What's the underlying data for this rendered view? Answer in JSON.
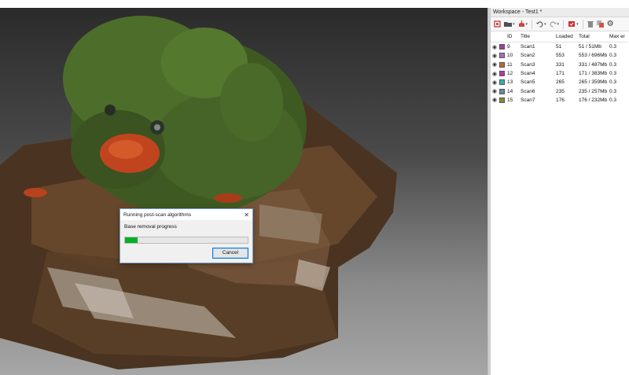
{
  "workspace": {
    "title": "Workspace - Test1 *",
    "columns": [
      "ID",
      "Title",
      "Loaded",
      "Total",
      "Max er"
    ],
    "rows": [
      {
        "id": "9",
        "title": "Scan1",
        "loaded": "51",
        "total": "51 / 51Mb",
        "max": "0.3",
        "color": "#9b3fa6"
      },
      {
        "id": "10",
        "title": "Scan2",
        "loaded": "553",
        "total": "553 / 696Mb",
        "max": "0.3",
        "color": "#b06ab8"
      },
      {
        "id": "11",
        "title": "Scan3",
        "loaded": "331",
        "total": "331 / 487Mb",
        "max": "0.3",
        "color": "#c06a30"
      },
      {
        "id": "12",
        "title": "Scan4",
        "loaded": "171",
        "total": "171 / 383Mb",
        "max": "0.3",
        "color": "#c030b0"
      },
      {
        "id": "13",
        "title": "Scan5",
        "loaded": "265",
        "total": "265 / 359Mb",
        "max": "0.3",
        "color": "#30b0b8"
      },
      {
        "id": "14",
        "title": "Scan6",
        "loaded": "235",
        "total": "235 / 257Mb",
        "max": "0.3",
        "color": "#6a8aa0"
      },
      {
        "id": "15",
        "title": "Scan7",
        "loaded": "176",
        "total": "176 / 232Mb",
        "max": "0.3",
        "color": "#8a8a30"
      }
    ]
  },
  "toolbar_icons": [
    "new-scan-icon",
    "open-folder-icon",
    "import-icon",
    "undo-icon",
    "redo-icon",
    "fusion-icon",
    "delete-icon",
    "copy-icon",
    "settings-icon"
  ],
  "dialog": {
    "title": "Running post-scan algorithms",
    "close_glyph": "✕",
    "label": "Base removal progress",
    "progress_fraction": 0.1,
    "cancel_label": "Cancel"
  }
}
